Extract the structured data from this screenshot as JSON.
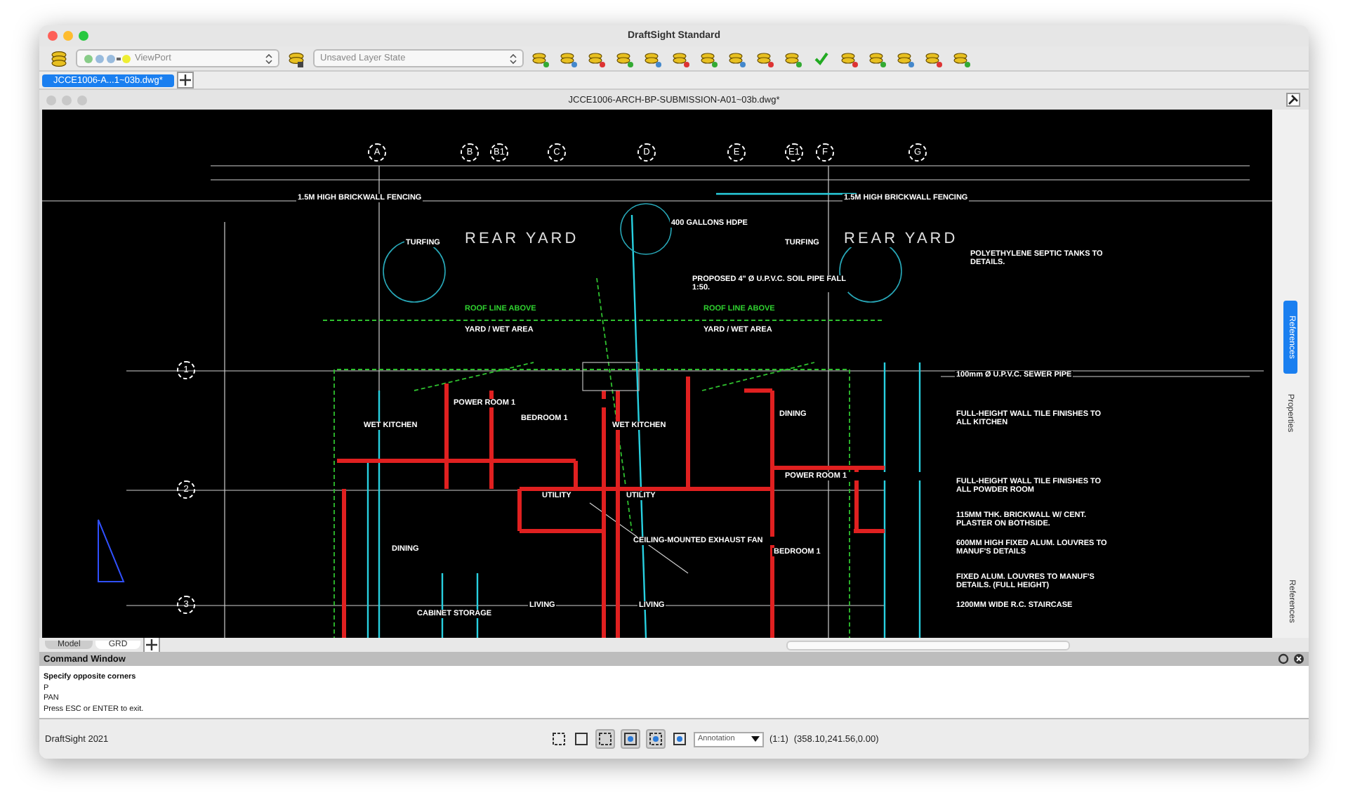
{
  "window": {
    "title": "DraftSight Standard"
  },
  "toolbar": {
    "layer_dropdown": "ViewPort",
    "layer_state_dropdown": "Unsaved Layer State"
  },
  "document_tabs": [
    {
      "label": "JCCE1006-A...1~03b.dwg*",
      "selected": true
    }
  ],
  "drawing_window": {
    "title": "JCCE1006-ARCH-BP-SUBMISSION-A01~03b.dwg*"
  },
  "drawing": {
    "column_bubbles": [
      "A",
      "B",
      "B1",
      "C",
      "D",
      "E",
      "E1",
      "F",
      "G"
    ],
    "row_bubbles": [
      "1",
      "2",
      "3"
    ],
    "labels": [
      "1.5M HIGH BRICKWALL FENCING",
      "1.5M HIGH BRICKWALL FENCING",
      "TURFING",
      "REAR YARD",
      "TURFING",
      "REAR YARD",
      "400 GALLONS HDPE",
      "PROPOSED 4\" Ø U.P.V.C. SOIL PIPE FALL 1:50.",
      "ROOF LINE ABOVE",
      "ROOF LINE ABOVE",
      "YARD / WET AREA",
      "YARD / WET AREA",
      "POLYETHYLENE SEPTIC TANKS TO DETAILS.",
      "100mm Ø U.P.V.C. SEWER PIPE",
      "WET KITCHEN",
      "WET KITCHEN",
      "POWER ROOM 1",
      "POWER ROOM 1",
      "BEDROOM 1",
      "BEDROOM 1",
      "DINING",
      "DINING",
      "UTILITY",
      "UTILITY",
      "CEILING-MOUNTED EXHAUST FAN",
      "LIVING",
      "LIVING",
      "CABINET STORAGE",
      "FULL-HEIGHT WALL TILE FINISHES TO ALL KITCHEN",
      "FULL-HEIGHT WALL TILE FINISHES TO ALL POWDER ROOM",
      "115MM THK. BRICKWALL W/ CENT. PLASTER ON BOTHSIDE.",
      "600MM HIGH FIXED ALUM. LOUVRES TO MANUF'S DETAILS",
      "FIXED ALUM. LOUVRES TO MANUF'S DETAILS. (FULL HEIGHT)",
      "1200MM WIDE R.C. STAIRCASE"
    ]
  },
  "side_panel": {
    "tabs": [
      {
        "label": "References",
        "selected": true
      },
      {
        "label": "Properties",
        "selected": false
      }
    ],
    "bottom_tab": "References"
  },
  "layout_tabs": [
    {
      "label": "Model",
      "selected": false
    },
    {
      "label": "GRD",
      "selected": true
    }
  ],
  "command_window": {
    "title": "Command Window",
    "lines": [
      "Specify opposite corners",
      "P",
      "PAN",
      "Press ESC or ENTER to exit."
    ]
  },
  "status_bar": {
    "app": "DraftSight 2021",
    "toggles": [
      {
        "on": false
      },
      {
        "on": false
      },
      {
        "on": true
      },
      {
        "on": true
      },
      {
        "on": true
      },
      {
        "on": false
      }
    ],
    "annotation": "Annotation",
    "scale": "(1:1)",
    "coordinates": "(358.10,241.56,0.00)"
  }
}
